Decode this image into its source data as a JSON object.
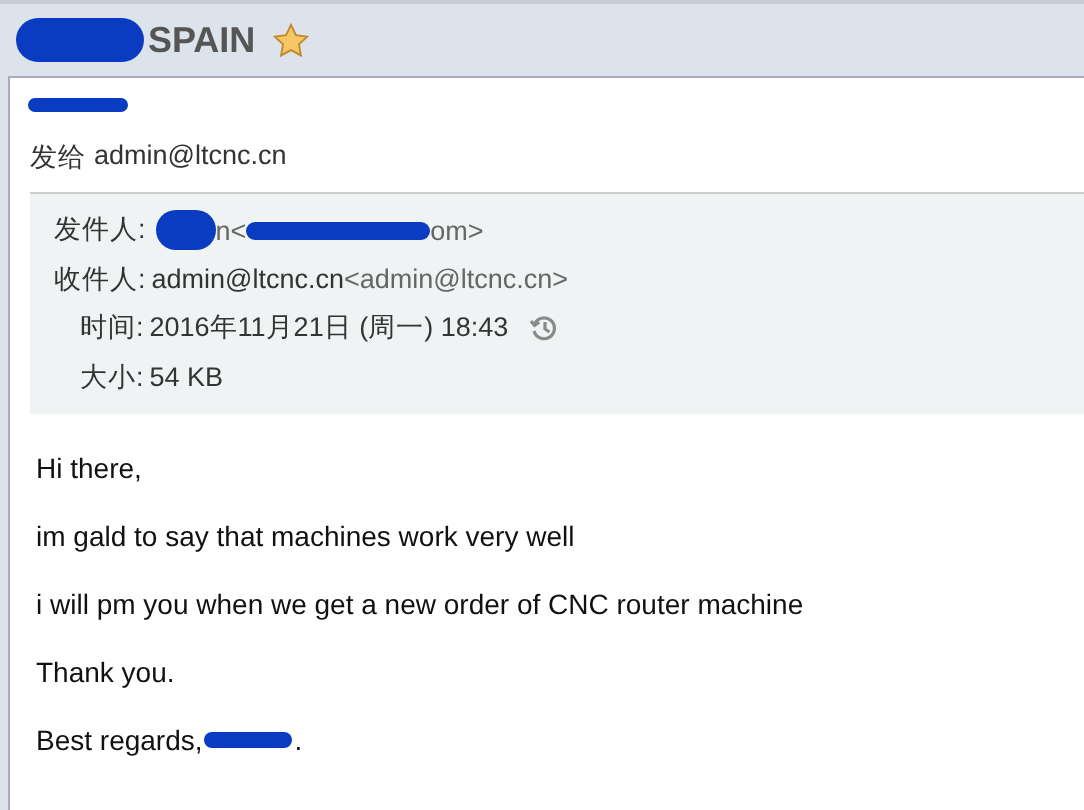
{
  "subject": {
    "text": "SPAIN",
    "starred": true
  },
  "recipient_line": {
    "label": "发给",
    "address": "admin@ltcnc.cn"
  },
  "details": {
    "from": {
      "label": "发件人:",
      "name_tail": "n",
      "address_open": "<",
      "address_tail": "om>"
    },
    "to": {
      "label": "收件人:",
      "name": "admin@ltcnc.cn",
      "address": "<admin@ltcnc.cn>"
    },
    "time": {
      "label": "时间:",
      "value": "2016年11月21日 (周一) 18:43"
    },
    "size": {
      "label": "大小:",
      "value": "54 KB"
    }
  },
  "body": [
    "Hi there,",
    "im gald to say that machines work very well",
    "i will pm you when we get a new order of CNC router machine",
    "Thank you."
  ],
  "closing": {
    "text": "Best regards,",
    "end": "."
  }
}
